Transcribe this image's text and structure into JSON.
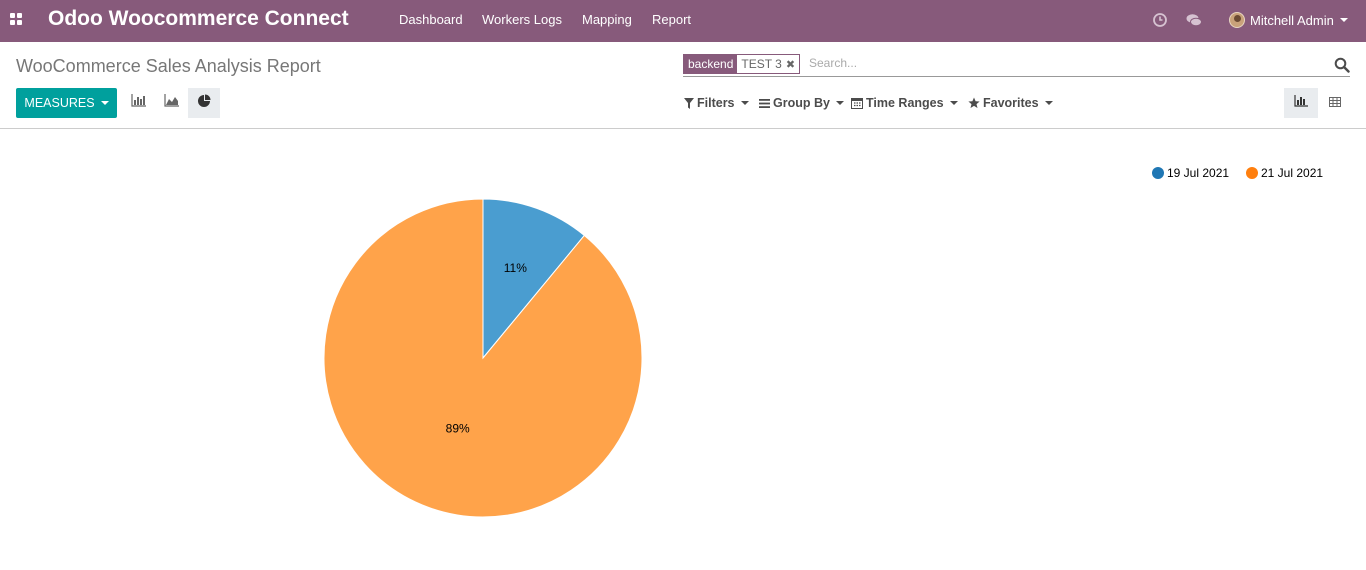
{
  "navbar": {
    "brand": "Odoo Woocommerce Connect",
    "menu": [
      "Dashboard",
      "Workers Logs",
      "Mapping",
      "Report"
    ],
    "user_name": "Mitchell Admin",
    "color": "#875a7b"
  },
  "control_panel": {
    "title": "WooCommerce Sales Analysis Report",
    "search": {
      "facet_category": "backend",
      "facet_value": "TEST 3",
      "placeholder": "Search..."
    },
    "measures_label": "MEASURES",
    "filters_label": "Filters",
    "group_by_label": "Group By",
    "time_ranges_label": "Time Ranges",
    "favorites_label": "Favorites",
    "accent_color": "#00a09d"
  },
  "icons": {
    "apps": "apps-grid-icon",
    "activity": "clock-icon",
    "messaging": "chat-icon",
    "search": "search-icon",
    "bar_chart": "bar-chart-icon",
    "line_chart": "area-chart-icon",
    "pie_chart": "pie-chart-icon",
    "filter": "filter-icon",
    "group_by": "list-icon",
    "time_ranges": "calendar-icon",
    "favorites": "star-icon",
    "graph_view": "bar-chart-icon",
    "pivot_view": "table-icon"
  },
  "chart_data": {
    "type": "pie",
    "title": "",
    "labels": [
      "19 Jul 2021",
      "21 Jul 2021"
    ],
    "values": [
      11,
      89
    ],
    "value_labels": [
      "11%",
      "89%"
    ],
    "colors": [
      "#4a9dd0",
      "#ffa34a"
    ],
    "legend_colors": [
      "#1f77b4",
      "#ff7f0e"
    ],
    "legend_position": "top-right"
  }
}
